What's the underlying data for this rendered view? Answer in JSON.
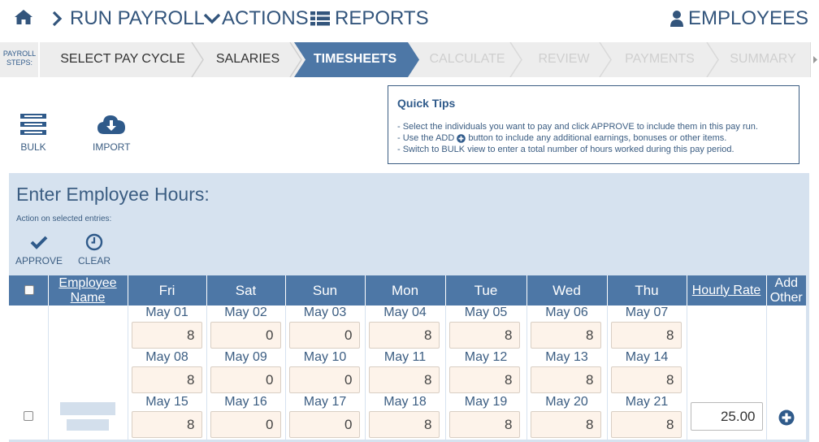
{
  "nav": {
    "run_payroll": "RUN PAYROLL",
    "actions": "ACTIONS",
    "reports": "REPORTS",
    "employees": "EMPLOYEES"
  },
  "steps": {
    "label": "PAYROLL STEPS:",
    "items": [
      {
        "label": "SELECT PAY CYCLE",
        "state": "done"
      },
      {
        "label": "SALARIES",
        "state": "done"
      },
      {
        "label": "TIMESHEETS",
        "state": "active"
      },
      {
        "label": "CALCULATE",
        "state": "disabled"
      },
      {
        "label": "REVIEW",
        "state": "disabled"
      },
      {
        "label": "PAYMENTS",
        "state": "disabled"
      },
      {
        "label": "SUMMARY",
        "state": "disabled"
      }
    ]
  },
  "toolbar": {
    "bulk": "BULK",
    "import": "IMPORT"
  },
  "tips": {
    "title": "Quick Tips",
    "line1": "- Select the individuals you want to pay and click APPROVE to include them in this pay run.",
    "line2_a": "- Use the ADD",
    "line2_b": "button to include any additional earnings, bonuses or other items.",
    "line3": "- Switch to BULK view to enter a total number of hours worked during this pay period."
  },
  "panel": {
    "title": "Enter Employee Hours:",
    "subtitle": "Action on selected entries:",
    "approve": "APPROVE",
    "clear": "CLEAR"
  },
  "table": {
    "headers": {
      "employee_name_1": "Employee",
      "employee_name_2": "Name",
      "days": [
        "Fri",
        "Sat",
        "Sun",
        "Mon",
        "Tue",
        "Wed",
        "Thu"
      ],
      "hourly_rate": "Hourly Rate",
      "add_other_1": "Add",
      "add_other_2": "Other"
    },
    "weeks": [
      {
        "dates": [
          "May 01",
          "May 02",
          "May 03",
          "May 04",
          "May 05",
          "May 06",
          "May 07"
        ],
        "hours": [
          "8",
          "0",
          "0",
          "8",
          "8",
          "8",
          "8"
        ]
      },
      {
        "dates": [
          "May 08",
          "May 09",
          "May 10",
          "May 11",
          "May 12",
          "May 13",
          "May 14"
        ],
        "hours": [
          "8",
          "0",
          "0",
          "8",
          "8",
          "8",
          "8"
        ]
      },
      {
        "dates": [
          "May 15",
          "May 16",
          "May 17",
          "May 18",
          "May 19",
          "May 20",
          "May 21"
        ],
        "hours": [
          "8",
          "0",
          "0",
          "8",
          "8",
          "8",
          "8"
        ]
      }
    ],
    "hourly_rate_value": "25.00"
  },
  "colors": {
    "accent": "#4d77a6",
    "nav_text": "#33557c",
    "panel_bg": "#d6e2ef",
    "input_bg": "#fdf3ea"
  }
}
